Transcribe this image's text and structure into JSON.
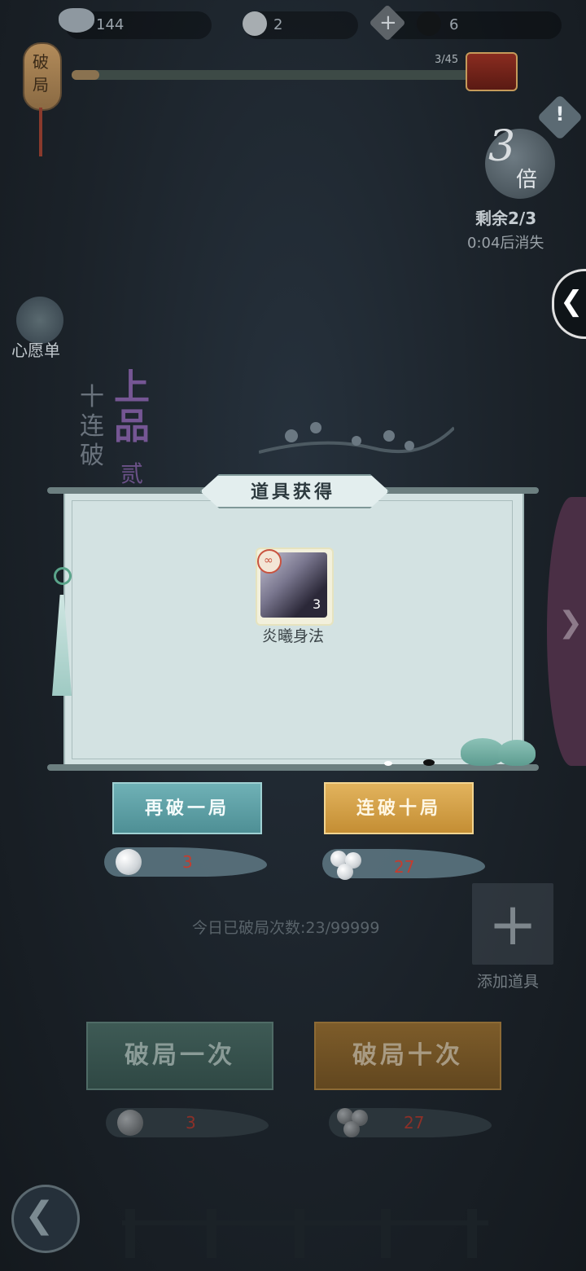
{
  "currency": {
    "silver": "144",
    "white_stones": "2",
    "black_stones": "6"
  },
  "progress": {
    "lantern_label": "破局",
    "counter": "3/45",
    "fraction": 0.067
  },
  "multiplier": {
    "number": "3",
    "unit": "倍",
    "remaining": "剩余2/3",
    "expire": "0:04后消失"
  },
  "wishlist": {
    "label": "心愿单"
  },
  "decor": {
    "callig_a": "十连破",
    "callig_b": "上品",
    "callig_c": "贰"
  },
  "dialog": {
    "title": "道具获得",
    "item": {
      "name": "炎曦身法",
      "count": "3"
    }
  },
  "buttons": {
    "again_one": "再破一局",
    "again_ten": "连破十局",
    "cost_one": "3",
    "cost_ten": "27"
  },
  "daily": {
    "text": "今日已破局次数:23/99999"
  },
  "add_item": {
    "label": "添加道具"
  },
  "bottom_buttons": {
    "break_one": "破局一次",
    "break_ten": "破局十次",
    "cost_one": "3",
    "cost_ten": "27"
  },
  "icons": {
    "back": "back-arrow-icon",
    "side": "chevron-left-icon"
  }
}
